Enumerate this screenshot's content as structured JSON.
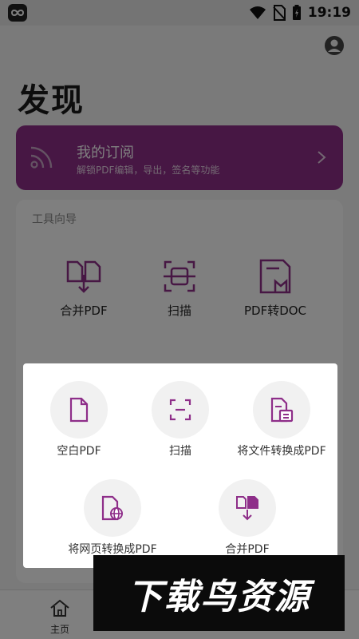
{
  "status_bar": {
    "time": "19:19",
    "icons": [
      "app-infinity-icon",
      "wifi-icon",
      "no-sim-icon",
      "battery-charging-icon"
    ]
  },
  "header": {
    "title": "发现",
    "avatar_icon": "account-circle-icon"
  },
  "subscription": {
    "title": "我的订阅",
    "description": "解锁PDF编辑，导出，签名等功能",
    "icon": "rss-feed-icon",
    "accent_color": "#8e2e89"
  },
  "tools": {
    "section_label": "工具向导",
    "items": [
      {
        "label": "合并PDF",
        "icon": "merge-pdf-icon"
      },
      {
        "label": "扫描",
        "icon": "scan-icon"
      },
      {
        "label": "PDF转DOC",
        "icon": "pdf-to-doc-icon"
      }
    ]
  },
  "create_sheet": {
    "options": [
      {
        "label": "空白PDF",
        "icon": "blank-document-icon"
      },
      {
        "label": "扫描",
        "icon": "scan-icon"
      },
      {
        "label": "将文件转换成PDF",
        "icon": "file-convert-icon"
      },
      {
        "label": "将网页转换成PDF",
        "icon": "webpage-convert-icon"
      },
      {
        "label": "合并PDF",
        "icon": "merge-pdf-icon"
      }
    ],
    "icon_color": "#8e2e89"
  },
  "bottom_nav": {
    "items": [
      {
        "label": "主页",
        "icon": "home-icon"
      }
    ]
  },
  "watermark": {
    "text": "下载鸟资源"
  }
}
